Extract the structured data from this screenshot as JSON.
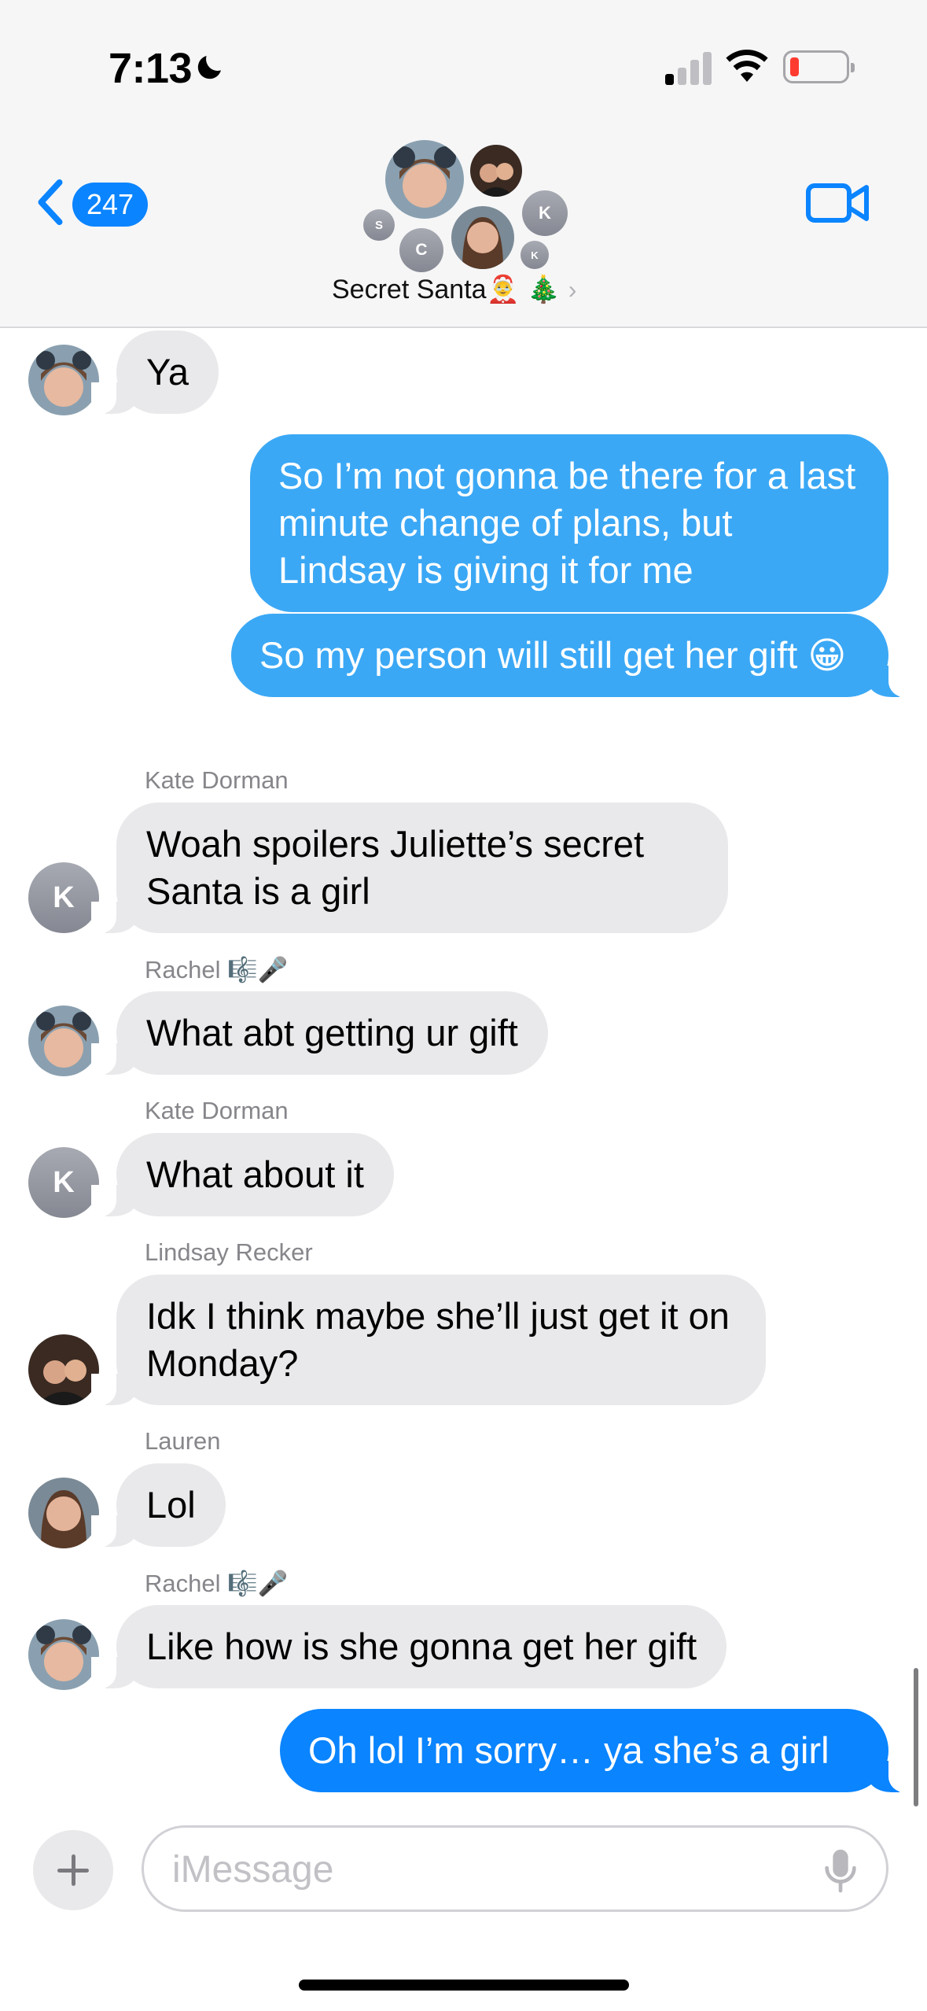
{
  "status_bar": {
    "time": "7:13",
    "focus_icon": "moon-icon",
    "signal_icon": "cellular-signal-icon",
    "wifi_icon": "wifi-icon",
    "battery_icon": "battery-low-icon",
    "battery_level": 0.12
  },
  "header": {
    "back_count": "247",
    "back_icon": "chevron-left-icon",
    "group_name": "Secret Santa🤶 🎄",
    "video_icon": "video-camera-icon",
    "avatar_initials": [
      "S",
      "C",
      "K",
      "K"
    ]
  },
  "messages": [
    {
      "type": "incoming",
      "text": "Ya"
    },
    {
      "type": "outgoing",
      "text": "So I’m not gonna be there for a last minute change of plans, but Lindsay is giving it for me"
    },
    {
      "type": "outgoing",
      "text": "So my person will still get her gift 😀"
    },
    {
      "type": "incoming",
      "sender": "Kate Dorman",
      "avatar_initial": "K",
      "text": "Woah spoilers Juliette’s secret Santa is a girl"
    },
    {
      "type": "incoming",
      "sender": "Rachel 🎼🎤",
      "text": "What abt getting ur gift"
    },
    {
      "type": "incoming",
      "sender": "Kate Dorman",
      "avatar_initial": "K",
      "text": "What about it"
    },
    {
      "type": "incoming",
      "sender": "Lindsay Recker",
      "text": "Idk I think maybe she’ll just get it on Monday?"
    },
    {
      "type": "incoming",
      "sender": "Lauren",
      "text": "Lol"
    },
    {
      "type": "incoming",
      "sender": "Rachel 🎼🎤",
      "text": "Like how is she gonna get her gift"
    },
    {
      "type": "outgoing",
      "text": "Oh lol I’m sorry… ya she’s a girl"
    }
  ],
  "compose": {
    "placeholder": "iMessage",
    "add_icon": "plus-icon",
    "mic_icon": "microphone-icon"
  },
  "colors": {
    "outgoing_bubble": "#3ba8f5",
    "outgoing_bubble_latest": "#0a84ff",
    "incoming_bubble": "#e9e9eb",
    "accent": "#0a84ff",
    "battery_low": "#ff3b30"
  }
}
